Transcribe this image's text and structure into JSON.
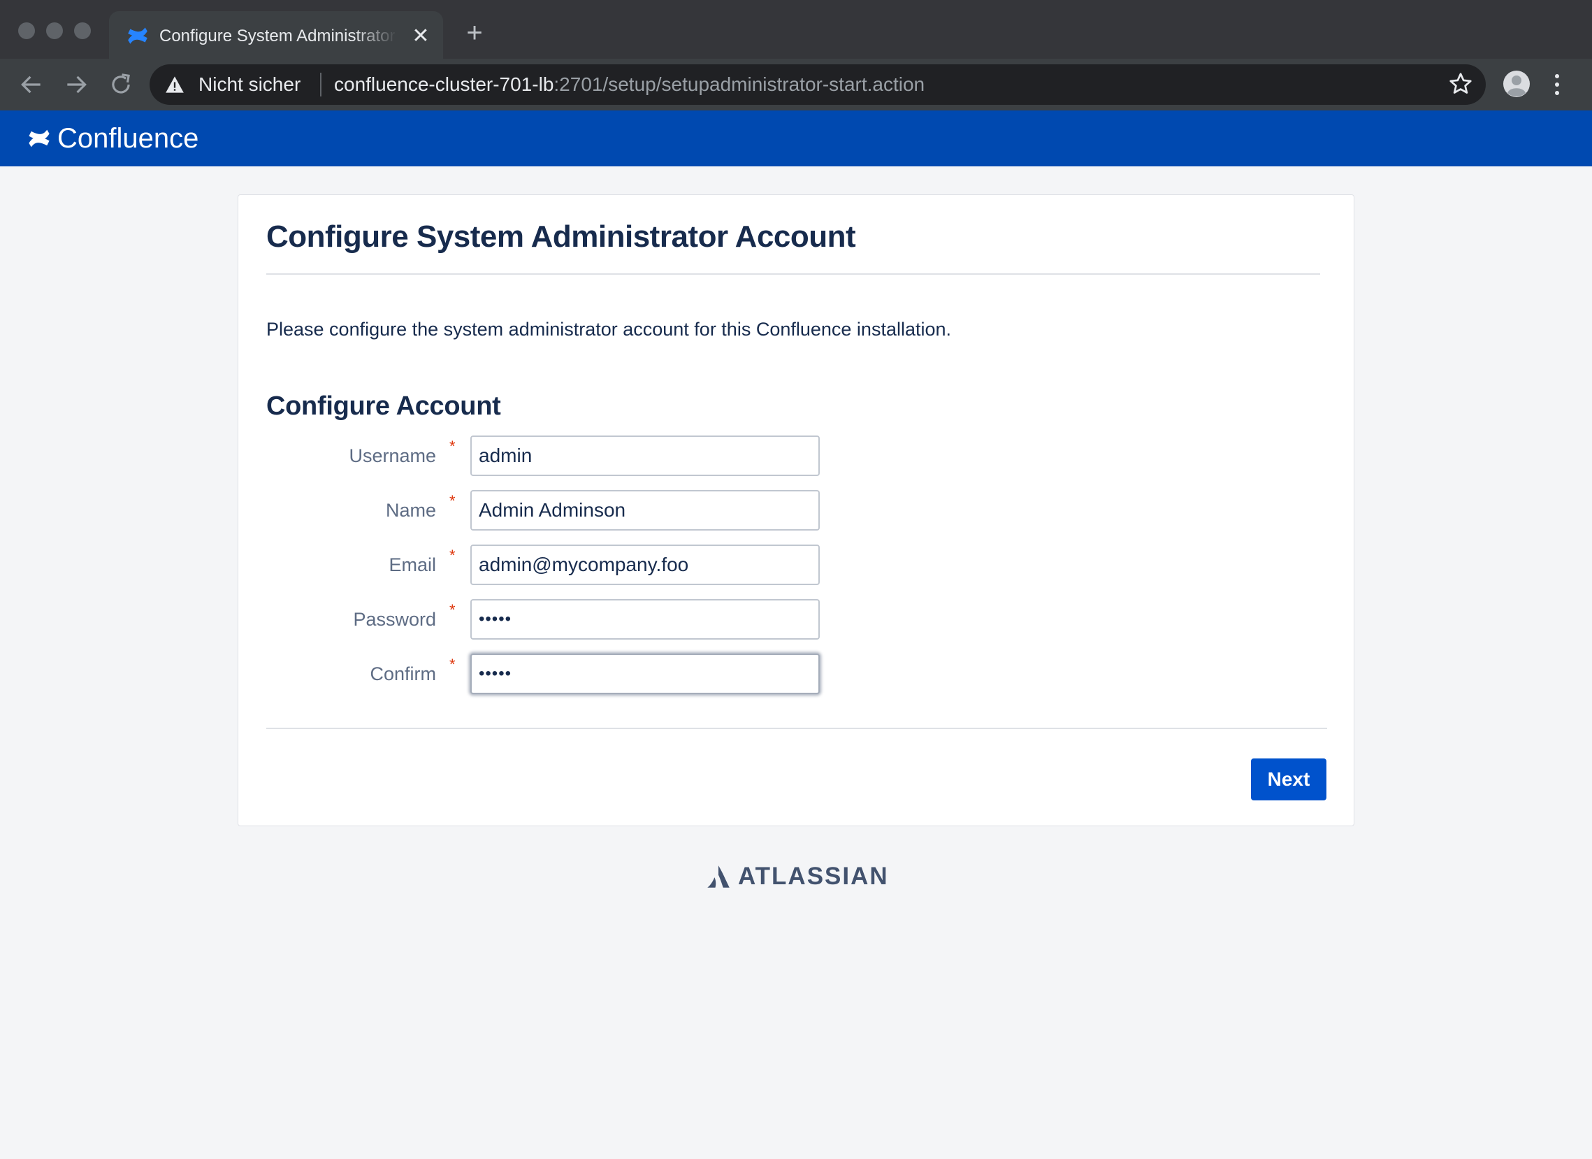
{
  "browser": {
    "tab_title": "Configure System Administrator Account",
    "tab_close_glyph": "✕",
    "new_tab_glyph": "+",
    "security_label": "Nicht sicher",
    "url_host": "confluence-cluster-701-lb",
    "url_path": ":2701/setup/setupadministrator-start.action",
    "icons": [
      "back-arrow-icon",
      "forward-arrow-icon",
      "reload-icon",
      "warning-icon",
      "star-icon",
      "profile-icon",
      "kebab-menu-icon"
    ]
  },
  "header": {
    "product_name": "Confluence",
    "brand_color": "#0049b0"
  },
  "page": {
    "title": "Configure System Administrator Account",
    "intro": "Please configure the system administrator account for this Confluence installation.",
    "section_title": "Configure Account",
    "required_marker": "*",
    "fields": [
      {
        "label": "Username",
        "value": "admin",
        "type": "text"
      },
      {
        "label": "Name",
        "value": "Admin Adminson",
        "type": "text"
      },
      {
        "label": "Email",
        "value": "admin@mycompany.foo",
        "type": "text"
      },
      {
        "label": "Password",
        "value": "•••••",
        "type": "password"
      },
      {
        "label": "Confirm",
        "value": "•••••",
        "type": "password",
        "focused": true
      }
    ],
    "next_button": "Next",
    "button_color": "#0052cc"
  },
  "footer": {
    "brand": "ATLASSIAN"
  }
}
